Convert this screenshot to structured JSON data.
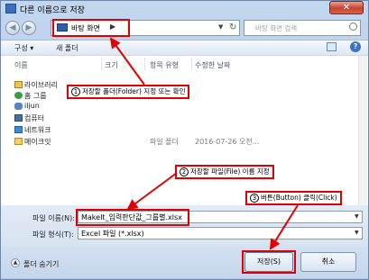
{
  "window": {
    "title": "다른 이름으로 저장",
    "close_glyph": "✕"
  },
  "nav": {
    "back_glyph": "◀",
    "forward_glyph": "▶",
    "address": "바탕 화면",
    "address_chevron": "▶",
    "address_dropdown_glyph": "▼",
    "refresh_glyph": "↻",
    "search_placeholder": "바탕 화면 검색"
  },
  "toolbar": {
    "organize": "구성 ▾",
    "new_folder": "새 폴더",
    "help_glyph": "?"
  },
  "columns": {
    "name": "이름",
    "size": "크기",
    "type": "항목 유형",
    "modified": "수정한 날짜"
  },
  "nav_items": [
    {
      "label": "라이브러리",
      "icon": "library-icon"
    },
    {
      "label": "홈 그룹",
      "icon": "homegroup-icon"
    },
    {
      "label": "iljun",
      "icon": "user-icon"
    },
    {
      "label": "컴퓨터",
      "icon": "computer-icon"
    },
    {
      "label": "네트워크",
      "icon": "network-icon"
    },
    {
      "label": "메이크잇",
      "icon": "folder-icon"
    }
  ],
  "folder_row": {
    "type": "파일 폴더",
    "date": "2016-07-26 오전..."
  },
  "form": {
    "filename_label": "파일 이름(N):",
    "filename_value": "MakeIt_입력판단값_그룹별.xlsx",
    "filetype_label": "파일 형식(T):",
    "filetype_value": "Excel 파일 (*.xlsx)",
    "dropdown_glyph": "▼"
  },
  "bottom": {
    "hide_folders": "폴더 숨기기",
    "hide_glyph": "▲",
    "save": "저장(S)",
    "cancel": "취소"
  },
  "callouts": {
    "step1": {
      "num": "1",
      "text": "저장할 폴더(Folder) 지정 또는 확인"
    },
    "step2": {
      "num": "2",
      "text": "저장할 파일(File) 이름 지정"
    },
    "step3": {
      "num": "3",
      "text": "버튼(Button) 클릭(Click)"
    }
  },
  "colors": {
    "callout_red": "#e00000",
    "title_bg": "#c2d6ee"
  }
}
